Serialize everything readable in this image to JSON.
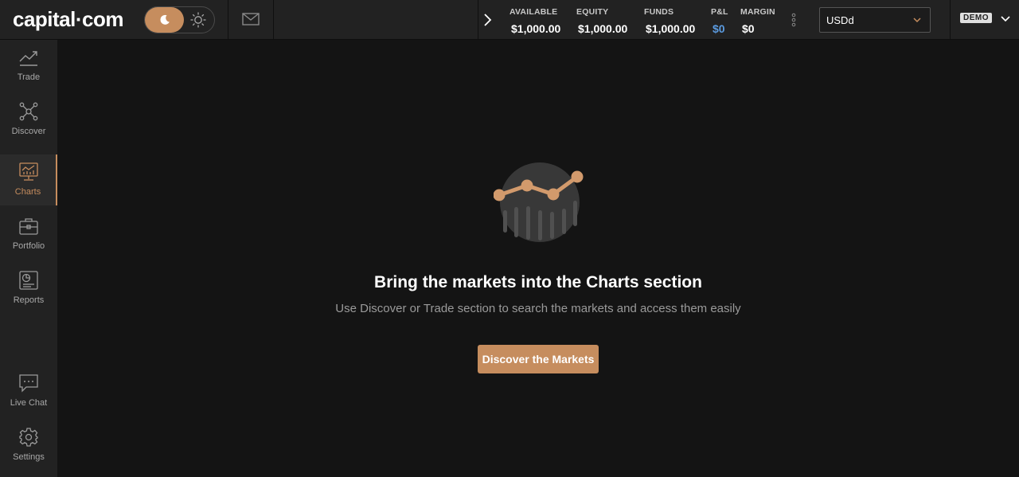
{
  "header": {
    "logo": "capital·com",
    "stats": [
      {
        "label": "AVAILABLE",
        "value": "$1,000.00"
      },
      {
        "label": "EQUITY",
        "value": "$1,000.00"
      },
      {
        "label": "FUNDS",
        "value": "$1,000.00"
      },
      {
        "label": "P&L",
        "value": "$0"
      },
      {
        "label": "MARGIN",
        "value": "$0"
      }
    ],
    "account_select": {
      "value": "USDd"
    },
    "mode_badge": "DEMO"
  },
  "sidebar": {
    "items": [
      {
        "label": "Trade",
        "icon": "trend-icon"
      },
      {
        "label": "Discover",
        "icon": "network-icon"
      },
      {
        "label": "Charts",
        "icon": "chart-monitor-icon",
        "active": true
      },
      {
        "label": "Portfolio",
        "icon": "briefcase-icon"
      },
      {
        "label": "Reports",
        "icon": "report-icon"
      },
      {
        "label": "Live Chat",
        "icon": "chat-icon"
      },
      {
        "label": "Settings",
        "icon": "gear-icon"
      }
    ]
  },
  "main": {
    "title": "Bring the markets into the Charts section",
    "subtitle": "Use Discover or Trade section to search the markets and access them easily",
    "cta_label": "Discover the Markets"
  },
  "colors": {
    "accent": "#c68d5e",
    "pnl": "#5b9be0",
    "background": "#141414",
    "panel": "#222222"
  }
}
